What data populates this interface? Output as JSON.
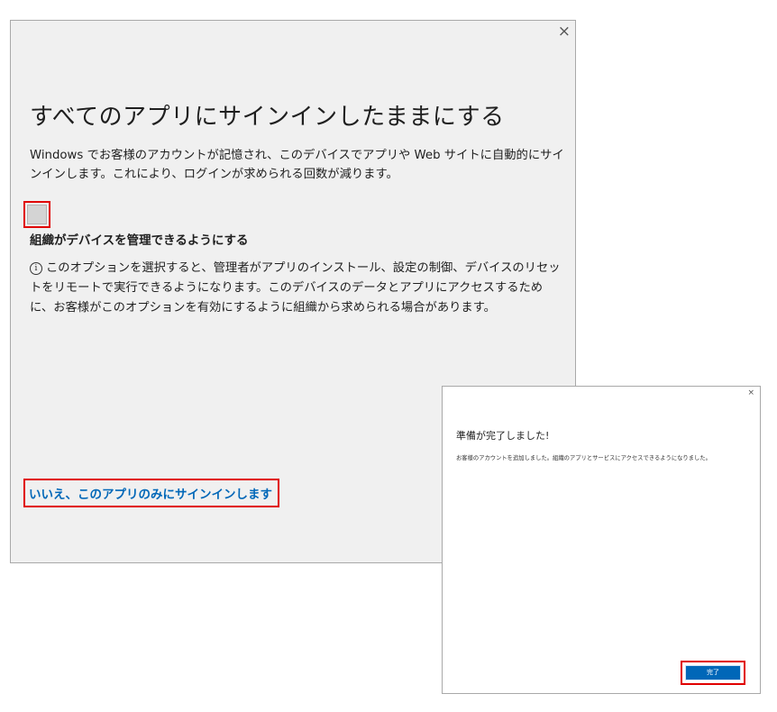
{
  "main_dialog": {
    "close_glyph": "×",
    "title": "すべてのアプリにサインインしたままにする",
    "description": "Windows でお客様のアカウントが記憶され、このデバイスでアプリや Web サイトに自動的にサインインします。これにより、ログインが求められる回数が減ります。",
    "checkbox": {
      "checked": false,
      "label": "組織がデバイスを管理できるようにする"
    },
    "info_icon": "info-circle",
    "info_glyph": "i",
    "info_text": "このオプションを選択すると、管理者がアプリのインストール、設定の制御、デバイスのリセットをリモートで実行できるようになります。このデバイスのデータとアプリにアクセスするために、お客様がこのオプションを有効にするように組織から求められる場合があります。",
    "signin_link": "いいえ、このアプリのみにサインインします"
  },
  "done_dialog": {
    "close_glyph": "×",
    "title": "準備が完了しました!",
    "description": "お客様のアカウントを追加しました。組織のアプリとサービスにアクセスできるようになりました。",
    "done_button": "完了"
  },
  "colors": {
    "highlight_border": "#e00000",
    "link": "#0067b8",
    "primary_button": "#0067b8",
    "main_dialog_bg": "#f0f0f0"
  }
}
